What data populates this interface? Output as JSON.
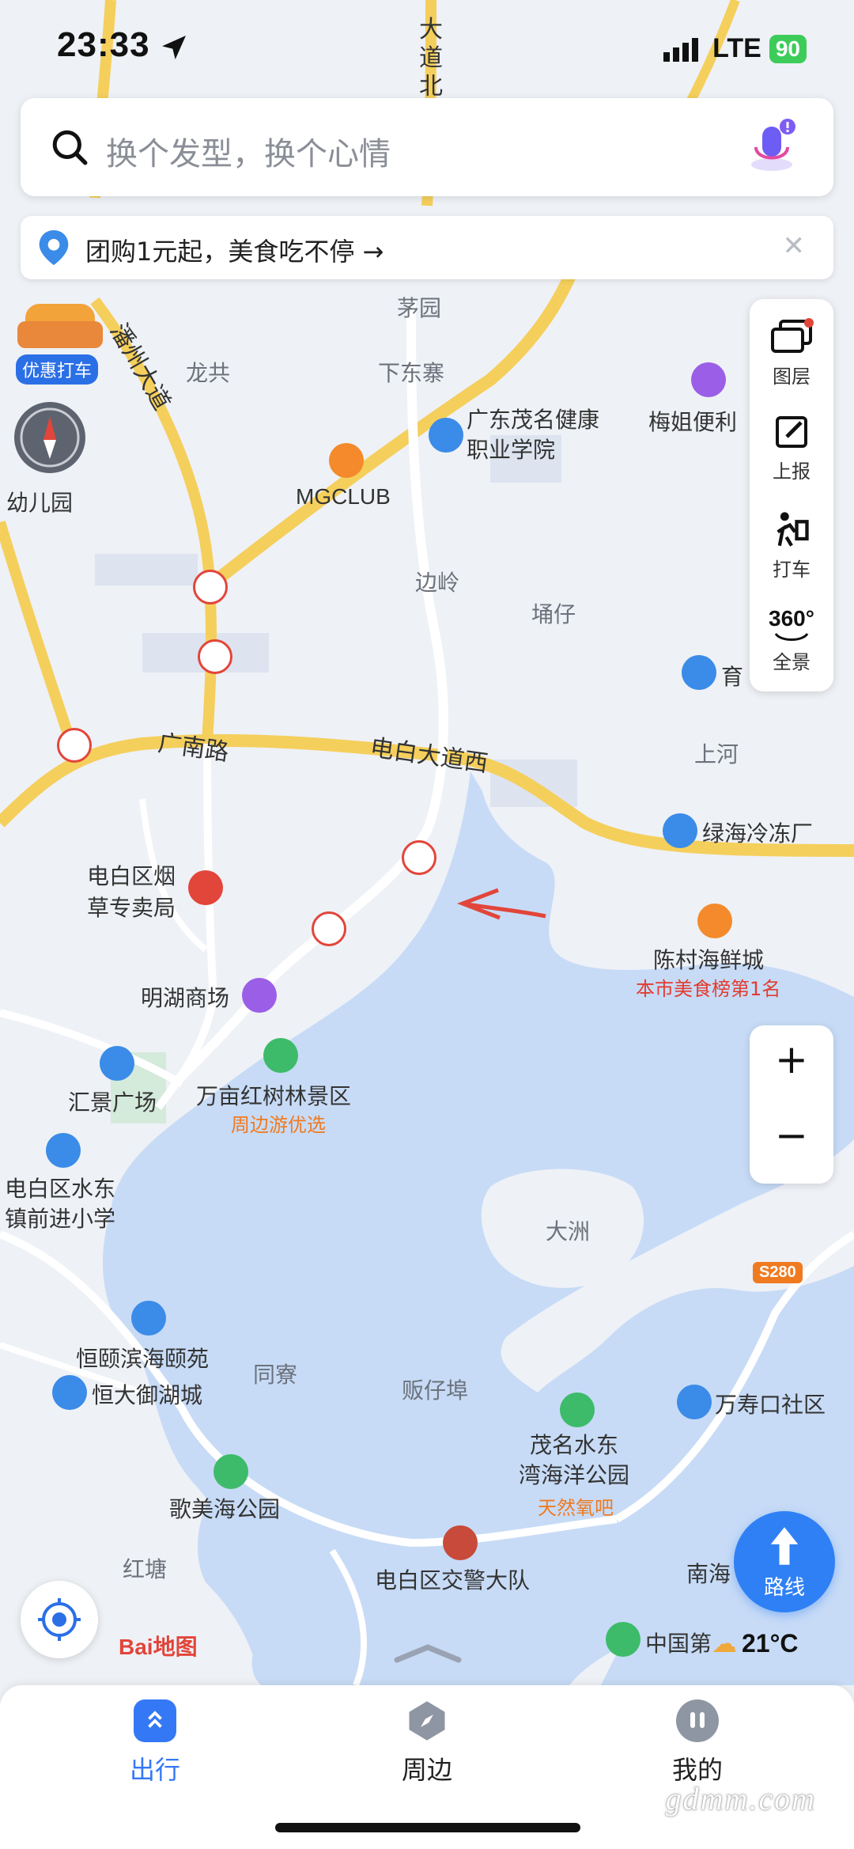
{
  "status": {
    "time": "23:33",
    "network": "LTE",
    "battery": "90"
  },
  "search": {
    "placeholder": "换个发型，换个心情"
  },
  "promo": {
    "text": "团购1元起，美食吃不停 →"
  },
  "toolbar": {
    "layers": "图层",
    "report": "上报",
    "taxi": "打车",
    "panorama": "全景",
    "panorama_badge": "360°"
  },
  "taxi_promo": "优惠打车",
  "zoom": {
    "in": "+",
    "out": "−"
  },
  "route_button": "路线",
  "weather": "21°C",
  "logo": "Bai地图",
  "map": {
    "roads": {
      "r1": "广南路",
      "r2": "电白大道西",
      "r3": "潘州大道",
      "r4": "大道北",
      "r5": "S280"
    },
    "places": {
      "maoyuan": "茅园",
      "longgong": "龙共",
      "xiadongzhai": "下东寨",
      "bianling": "边岭",
      "yongzai": "埇仔",
      "shanghe": "上河",
      "dazhou": "大洲",
      "tongliao": "同寮",
      "fanzaibu": "贩仔埠",
      "hongtang": "红塘",
      "guangdong": "广东茂名健康\n职业学院",
      "mgclub": "MGCLUB",
      "meijie": "梅姐便利",
      "youeryuan": "幼儿园",
      "dianbai_yancao": "电白区烟\n草专卖局",
      "minghu": "明湖商场",
      "wanmu": "万亩红树林景区",
      "wanmu_tag": "周边游优选",
      "huijing": "汇景广场",
      "shuidong_school": "电白区水东\n镇前进小学",
      "henyi": "恒颐滨海颐苑",
      "hengda": "恒大御湖城",
      "gemei": "歌美海公园",
      "jiaojing": "电白区交警大队",
      "zhongguo": "中国第",
      "chencun": "陈村海鲜城",
      "chencun_tag": "本市美食榜第1名",
      "lvhai": "绿海冷冻厂",
      "wanshou": "万寿口社区",
      "maoming_park": "茂名水东\n湾海洋公园",
      "maoming_tag": "天然氧吧",
      "nanhai": "南海",
      "yu": "育"
    }
  },
  "tabs": [
    {
      "label": "出行"
    },
    {
      "label": "周边"
    },
    {
      "label": "我的"
    }
  ],
  "watermark": "gdmm.com",
  "colors": {
    "water": "#c7dbf6",
    "land": "#eef1f6",
    "road": "#f5cf5c",
    "accent": "#3478f6"
  }
}
